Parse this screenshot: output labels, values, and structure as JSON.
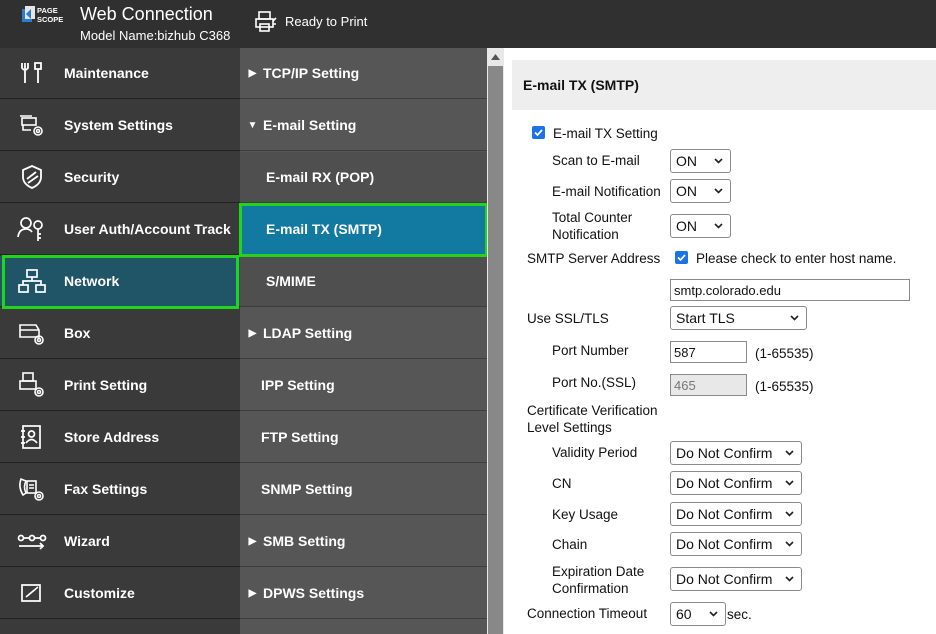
{
  "header": {
    "logo_text_1": "PAGE",
    "logo_text_2": "SCOPE",
    "app_title": "Web Connection",
    "model_name": "Model Name:bizhub C368",
    "status": "Ready to Print"
  },
  "left_nav": [
    {
      "label": "Maintenance",
      "icon": "maintenance-icon"
    },
    {
      "label": "System Settings",
      "icon": "system-settings-icon"
    },
    {
      "label": "Security",
      "icon": "shield-icon"
    },
    {
      "label": "User Auth/Account Track",
      "icon": "user-key-icon"
    },
    {
      "label": "Network",
      "icon": "network-icon",
      "active": true
    },
    {
      "label": "Box",
      "icon": "box-icon"
    },
    {
      "label": "Print Setting",
      "icon": "print-setting-icon"
    },
    {
      "label": "Store Address",
      "icon": "address-book-icon"
    },
    {
      "label": "Fax Settings",
      "icon": "fax-icon"
    },
    {
      "label": "Wizard",
      "icon": "wizard-icon"
    },
    {
      "label": "Customize",
      "icon": "customize-icon"
    }
  ],
  "mid_nav": [
    {
      "label": "TCP/IP Setting",
      "arrow": "▶"
    },
    {
      "label": "E-mail Setting",
      "arrow": "▼"
    },
    {
      "label": "E-mail RX (POP)",
      "arrow": ""
    },
    {
      "label": "E-mail TX (SMTP)",
      "arrow": "",
      "active": true
    },
    {
      "label": "S/MIME",
      "arrow": ""
    },
    {
      "label": "LDAP Setting",
      "arrow": "▶"
    },
    {
      "label": "IPP Setting",
      "arrow": ""
    },
    {
      "label": "FTP Setting",
      "arrow": ""
    },
    {
      "label": "SNMP Setting",
      "arrow": ""
    },
    {
      "label": "SMB Setting",
      "arrow": "▶"
    },
    {
      "label": "DPWS Settings",
      "arrow": "▶"
    }
  ],
  "content": {
    "title": "E-mail TX (SMTP)",
    "email_tx_setting": {
      "label": "E-mail TX Setting",
      "checked": true
    },
    "scan_to_email": {
      "label": "Scan to E-mail",
      "value": "ON"
    },
    "email_notification": {
      "label": "E-mail Notification",
      "value": "ON"
    },
    "total_counter_notification": {
      "label_line1": "Total Counter",
      "label_line2": "Notification",
      "value": "ON"
    },
    "smtp_server_address": {
      "label": "SMTP Server Address",
      "check_label": "Please check to enter host name.",
      "checked": true,
      "value": "smtp.colorado.edu"
    },
    "use_ssl_tls": {
      "label": "Use SSL/TLS",
      "value": "Start TLS"
    },
    "port_number": {
      "label": "Port Number",
      "value": "587",
      "range": "(1-65535)"
    },
    "port_no_ssl": {
      "label": "Port No.(SSL)",
      "value": "465",
      "range": "(1-65535)"
    },
    "cert_verification": {
      "label_line1": "Certificate Verification",
      "label_line2": "Level Settings"
    },
    "validity_period": {
      "label": "Validity Period",
      "value": "Do Not Confirm"
    },
    "cn": {
      "label": "CN",
      "value": "Do Not Confirm"
    },
    "key_usage": {
      "label": "Key Usage",
      "value": "Do Not Confirm"
    },
    "chain": {
      "label": "Chain",
      "value": "Do Not Confirm"
    },
    "expiration_date": {
      "label_line1": "Expiration Date",
      "label_line2": "Confirmation",
      "value": "Do Not Confirm"
    },
    "connection_timeout": {
      "label": "Connection Timeout",
      "value": "60",
      "unit": "sec."
    }
  },
  "colors": {
    "highlight": "#21d51c",
    "active_left": "#1f5566",
    "active_mid": "#1279a0"
  }
}
